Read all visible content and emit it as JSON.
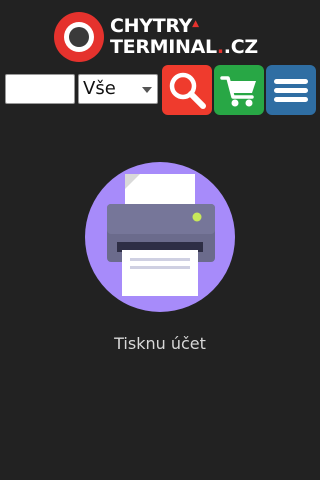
{
  "logo": {
    "line1": "CHYTRY",
    "line2": "TERMINAL",
    "tld": ".CZ",
    "accent": "#e5322d"
  },
  "toolbar": {
    "search_value": "",
    "category_selected": "Vše",
    "search_button_icon": "magnifier-icon",
    "cart_button_icon": "cart-icon",
    "menu_button_icon": "hamburger-icon",
    "colors": {
      "search": "#ef3b2d",
      "cart": "#28a745",
      "menu": "#2f6ea3"
    }
  },
  "main": {
    "illustration_icon": "printer-icon",
    "status_text": "Tisknu účet"
  },
  "colors": {
    "background": "#222222",
    "illustration_circle": "#a78bfa"
  }
}
